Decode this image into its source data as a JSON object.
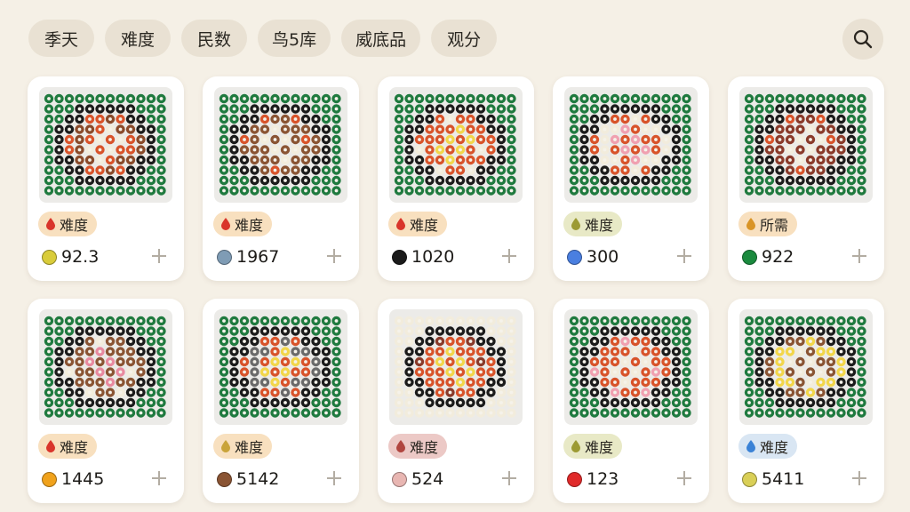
{
  "filters": [
    {
      "label": "季天"
    },
    {
      "label": "难度"
    },
    {
      "label": "民数"
    },
    {
      "label": "鸟5库"
    },
    {
      "label": "威底品"
    },
    {
      "label": "观分"
    }
  ],
  "search": {
    "icon": "search-icon"
  },
  "cards": [
    {
      "badge": {
        "label": "难度",
        "bg": "#f8e0bf",
        "color": "#d9352b"
      },
      "count": "92.3",
      "swatch": "#d9cc3a"
    },
    {
      "badge": {
        "label": "难度",
        "bg": "#f8e0bf",
        "color": "#d9352b"
      },
      "count": "1967",
      "swatch": "#7f9cb5"
    },
    {
      "badge": {
        "label": "难度",
        "bg": "#f8e0bf",
        "color": "#d9352b"
      },
      "count": "1020",
      "swatch": "#1b1b1b"
    },
    {
      "badge": {
        "label": "难度",
        "bg": "#e8e9c6",
        "color": "#9c9a33"
      },
      "count": "300",
      "swatch": "#4a7fe0"
    },
    {
      "badge": {
        "label": "所需",
        "bg": "#f8e0bf",
        "color": "#d99425"
      },
      "count": "922",
      "swatch": "#1a8a3e"
    },
    {
      "badge": {
        "label": "难度",
        "bg": "#f8e0bf",
        "color": "#d9352b"
      },
      "count": "1445",
      "swatch": "#f0a21c"
    },
    {
      "badge": {
        "label": "难度",
        "bg": "#f8e0bf",
        "color": "#c9a43a"
      },
      "count": "5142",
      "swatch": "#8a5433"
    },
    {
      "badge": {
        "label": "难度",
        "bg": "#ecc9c6",
        "color": "#b0453f"
      },
      "count": "524",
      "swatch": "#e8b6b2"
    },
    {
      "badge": {
        "label": "难度",
        "bg": "#e8e9c6",
        "color": "#9c9a33"
      },
      "count": "123",
      "swatch": "#e02a2a"
    },
    {
      "badge": {
        "label": "难度",
        "bg": "#d9e6f3",
        "color": "#3a82d6"
      },
      "count": "5411",
      "swatch": "#d9cf57"
    }
  ]
}
